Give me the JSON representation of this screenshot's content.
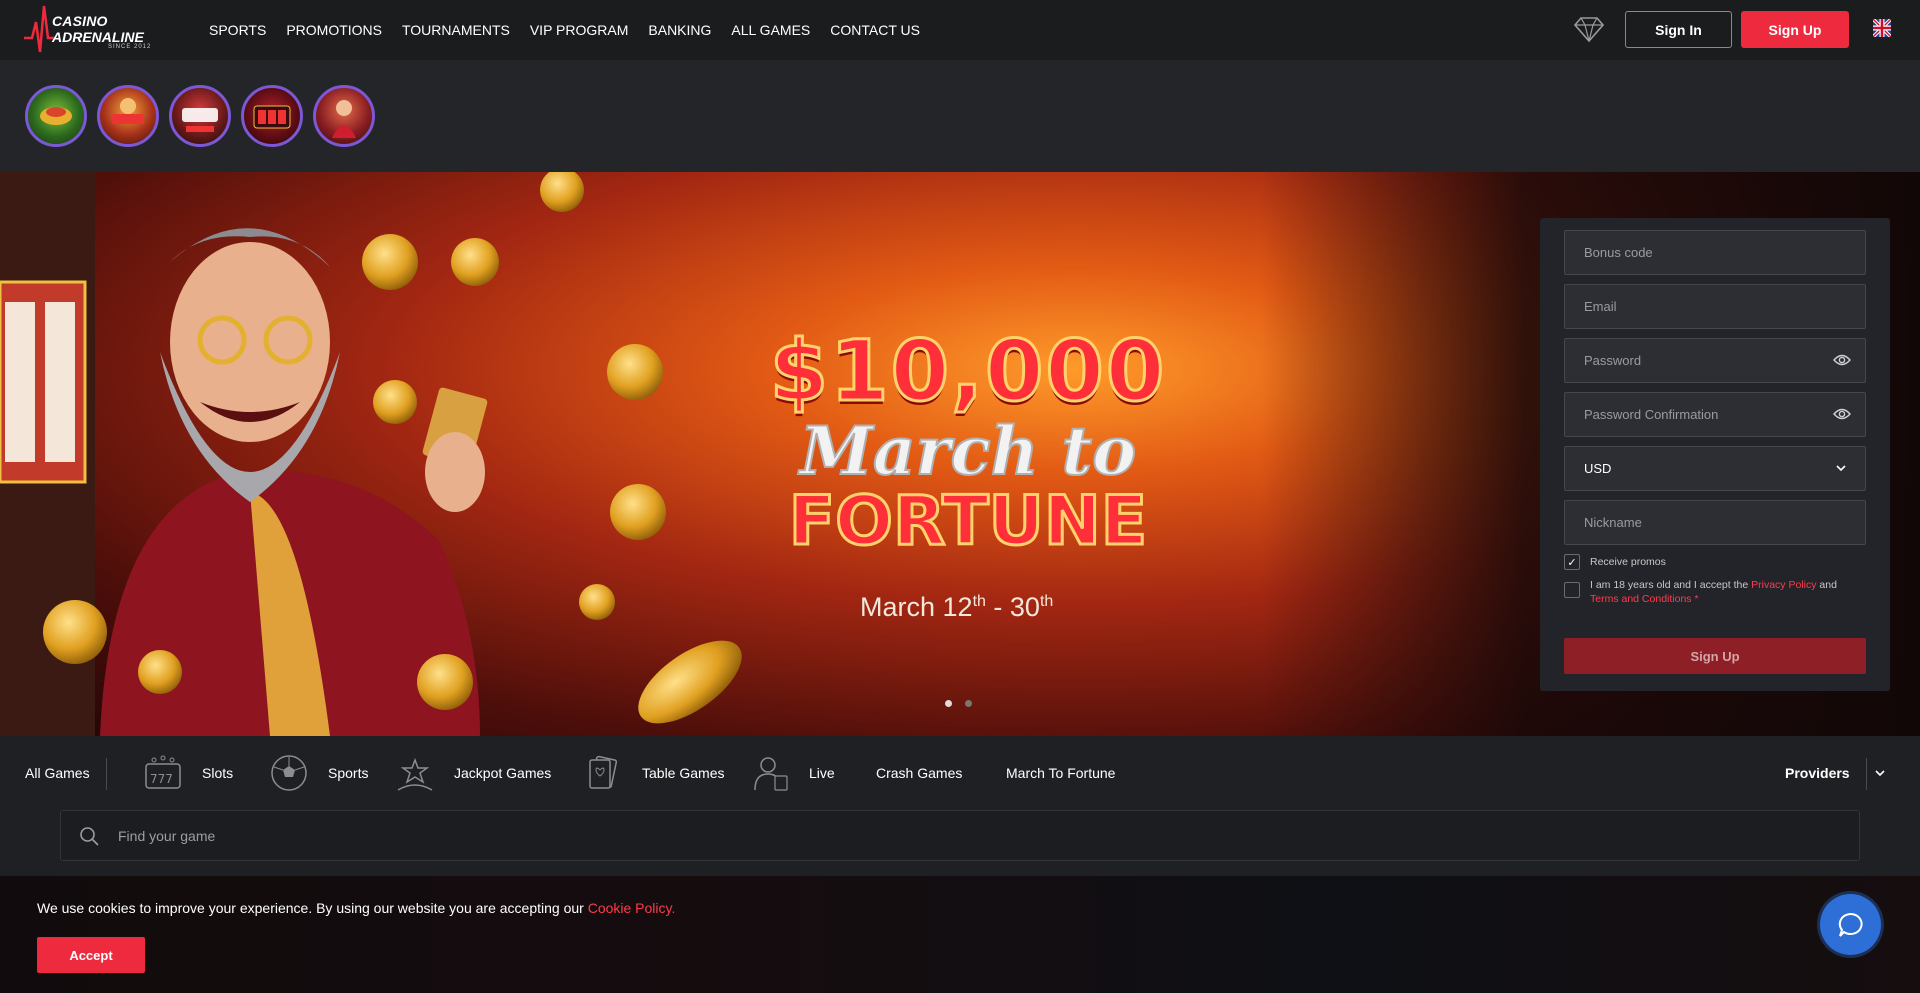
{
  "brand": {
    "line1": "CASINO",
    "line2": "ADRENALINE",
    "since": "SINCE 2012",
    "accent_color": "#ee2a3f"
  },
  "nav": {
    "items": [
      {
        "label": "SPORTS"
      },
      {
        "label": "PROMOTIONS"
      },
      {
        "label": "TOURNAMENTS"
      },
      {
        "label": "VIP PROGRAM"
      },
      {
        "label": "BANKING"
      },
      {
        "label": "ALL GAMES"
      },
      {
        "label": "CONTACT US"
      }
    ]
  },
  "header": {
    "vip_icon": "diamond-icon",
    "sign_in_label": "Sign In",
    "sign_up_label": "Sign Up",
    "language_icon": "uk-flag-icon"
  },
  "promo_strip": {
    "items": [
      {
        "name": "promo-story-1"
      },
      {
        "name": "promo-story-2"
      },
      {
        "name": "promo-story-3"
      },
      {
        "name": "promo-story-4"
      },
      {
        "name": "promo-story-5"
      }
    ]
  },
  "hero": {
    "amount": "$10,000",
    "line1": "March to",
    "line2": "FORTUNE",
    "date_start": "March 12",
    "date_start_suffix": "th",
    "date_sep": " - 30",
    "date_end_suffix": "th",
    "slides": 2,
    "active_slide": 1
  },
  "signup_form": {
    "bonus_code_placeholder": "Bonus code",
    "email_placeholder": "Email",
    "password_placeholder": "Password",
    "password_confirm_placeholder": "Password Confirmation",
    "currency_value": "USD",
    "nickname_placeholder": "Nickname",
    "receive_promos_label": "Receive promos",
    "receive_promos_checked": true,
    "terms_prefix": "I am 18 years old and I accept the ",
    "privacy_link": "Privacy Policy",
    "terms_and": " and",
    "terms_link": "Terms and Conditions",
    "terms_suffix": " *",
    "terms_checked": false,
    "submit_label": "Sign Up"
  },
  "categories": {
    "all_games": "All Games",
    "items": [
      {
        "label": "Slots",
        "icon": "slot-machine-icon"
      },
      {
        "label": "Sports",
        "icon": "soccer-ball-icon"
      },
      {
        "label": "Jackpot Games",
        "icon": "jackpot-star-icon"
      },
      {
        "label": "Table Games",
        "icon": "playing-cards-icon"
      },
      {
        "label": "Live",
        "icon": "live-dealer-icon"
      },
      {
        "label": "Crash Games"
      },
      {
        "label": "March To Fortune"
      }
    ],
    "providers_label": "Providers"
  },
  "search": {
    "placeholder": "Find your game"
  },
  "cookie": {
    "text": "We use cookies to improve your experience. By using our website you are accepting our ",
    "link": "Cookie Policy.",
    "accept_label": "Accept"
  },
  "chat": {
    "icon": "chat-bubble-icon",
    "color": "#2d6fd6"
  }
}
